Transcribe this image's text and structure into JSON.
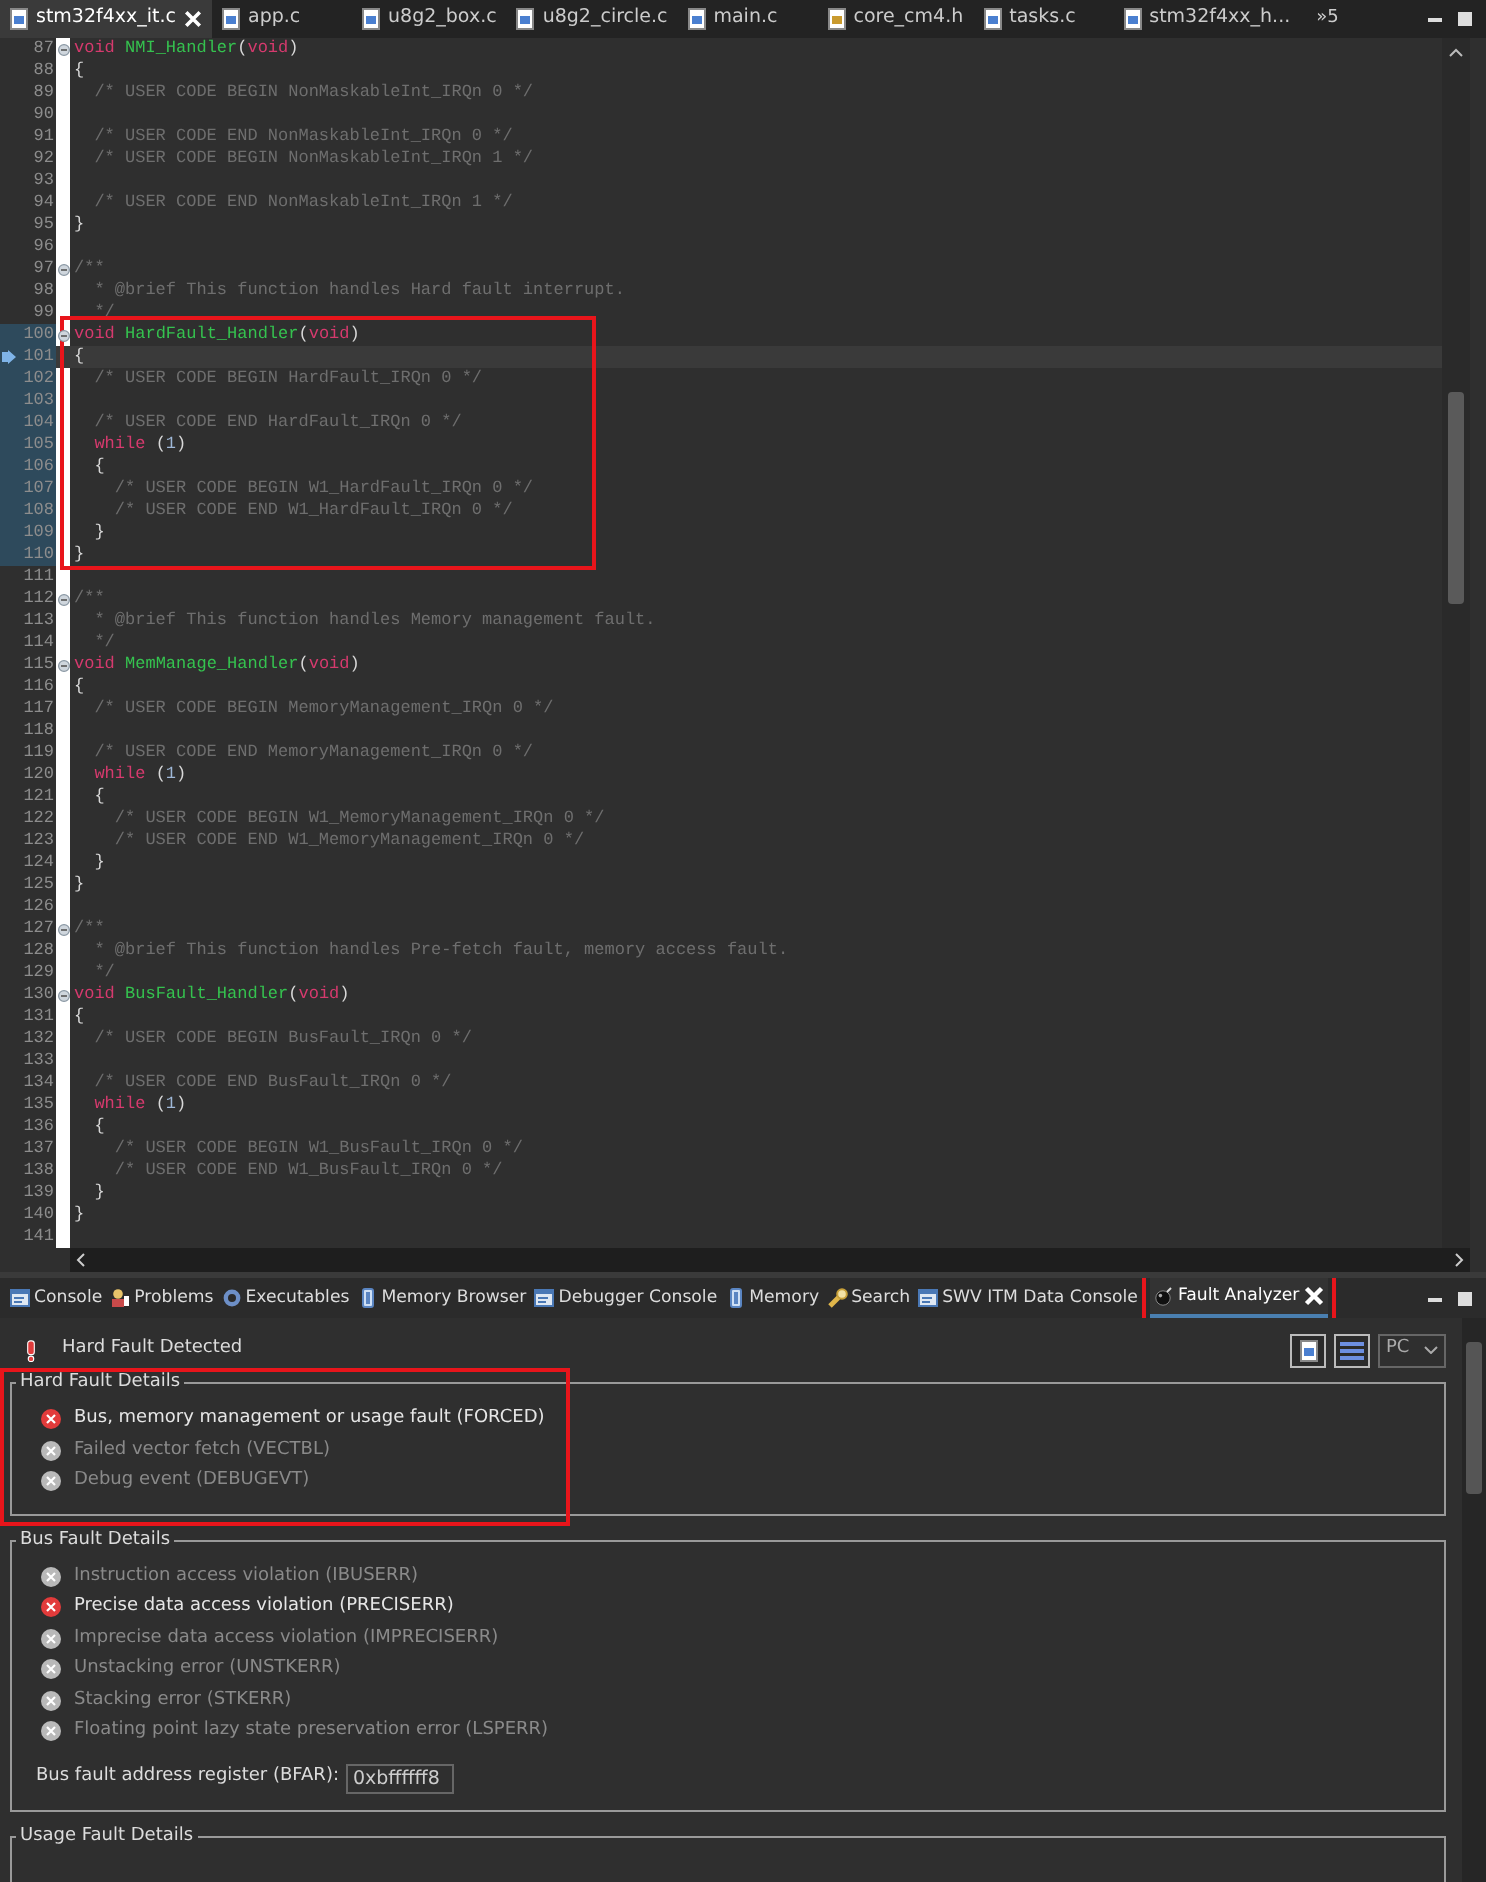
{
  "editor_tabs": [
    {
      "label": "stm32f4xx_it.c",
      "kind": "source",
      "selected": true,
      "closable": true
    },
    {
      "label": "app.c",
      "kind": "source",
      "selected": false
    },
    {
      "label": "u8g2_box.c",
      "kind": "source",
      "selected": false
    },
    {
      "label": "u8g2_circle.c",
      "kind": "source",
      "selected": false
    },
    {
      "label": "main.c",
      "kind": "source",
      "selected": false
    },
    {
      "label": "core_cm4.h",
      "kind": "header",
      "selected": false
    },
    {
      "label": "tasks.c",
      "kind": "source",
      "selected": false
    },
    {
      "label": "stm32f4xx_h...",
      "kind": "source",
      "selected": false
    }
  ],
  "editor_overflow": "»5",
  "code": {
    "lines": [
      {
        "number": "87",
        "fold": true,
        "tokens": [
          {
            "kind": "keyword",
            "text": "void "
          },
          {
            "kind": "function",
            "text": "NMI_Handler"
          },
          {
            "kind": "plain",
            "text": "("
          },
          {
            "kind": "keyword",
            "text": "void"
          },
          {
            "kind": "plain",
            "text": ")"
          }
        ]
      },
      {
        "number": "88",
        "tokens": [
          {
            "kind": "plain",
            "text": "{"
          }
        ]
      },
      {
        "number": "89",
        "tokens": [
          {
            "kind": "comment",
            "text": "  /* USER CODE BEGIN NonMaskableInt_IRQn 0 */"
          }
        ]
      },
      {
        "number": "90"
      },
      {
        "number": "91",
        "tokens": [
          {
            "kind": "comment",
            "text": "  /* USER CODE END NonMaskableInt_IRQn 0 */"
          }
        ]
      },
      {
        "number": "92",
        "tokens": [
          {
            "kind": "comment",
            "text": "  /* USER CODE BEGIN NonMaskableInt_IRQn 1 */"
          }
        ]
      },
      {
        "number": "93"
      },
      {
        "number": "94",
        "tokens": [
          {
            "kind": "comment",
            "text": "  /* USER CODE END NonMaskableInt_IRQn 1 */"
          }
        ]
      },
      {
        "number": "95",
        "tokens": [
          {
            "kind": "plain",
            "text": "}"
          }
        ]
      },
      {
        "number": "96"
      },
      {
        "number": "97",
        "fold": true,
        "tokens": [
          {
            "kind": "comment",
            "text": "/**"
          }
        ]
      },
      {
        "number": "98",
        "tokens": [
          {
            "kind": "comment",
            "text": "  * @brief This function handles Hard fault interrupt."
          }
        ]
      },
      {
        "number": "99",
        "tokens": [
          {
            "kind": "comment",
            "text": "  */"
          }
        ]
      },
      {
        "number": "100",
        "fold": true,
        "marked": true,
        "boxed": true,
        "tokens": [
          {
            "kind": "keyword",
            "text": "void "
          },
          {
            "kind": "function",
            "text": "HardFault_Handler"
          },
          {
            "kind": "plain",
            "text": "("
          },
          {
            "kind": "keyword",
            "text": "void"
          },
          {
            "kind": "plain",
            "text": ")"
          }
        ]
      },
      {
        "number": "101",
        "marked": true,
        "boxed": true,
        "current": true,
        "tokens": [
          {
            "kind": "plain",
            "text": "{"
          }
        ]
      },
      {
        "number": "102",
        "marked": true,
        "boxed": true,
        "tokens": [
          {
            "kind": "comment",
            "text": "  /* USER CODE BEGIN HardFault_IRQn 0 */"
          }
        ]
      },
      {
        "number": "103",
        "marked": true,
        "boxed": true
      },
      {
        "number": "104",
        "marked": true,
        "boxed": true,
        "tokens": [
          {
            "kind": "comment",
            "text": "  /* USER CODE END HardFault_IRQn 0 */"
          }
        ]
      },
      {
        "number": "105",
        "marked": true,
        "boxed": true,
        "tokens": [
          {
            "kind": "keyword",
            "text": "  while "
          },
          {
            "kind": "plain",
            "text": "("
          },
          {
            "kind": "number",
            "text": "1"
          },
          {
            "kind": "plain",
            "text": ")"
          }
        ]
      },
      {
        "number": "106",
        "marked": true,
        "boxed": true,
        "tokens": [
          {
            "kind": "plain",
            "text": "  {"
          }
        ]
      },
      {
        "number": "107",
        "marked": true,
        "boxed": true,
        "tokens": [
          {
            "kind": "comment",
            "text": "    /* USER CODE BEGIN W1_HardFault_IRQn 0 */"
          }
        ]
      },
      {
        "number": "108",
        "marked": true,
        "boxed": true,
        "tokens": [
          {
            "kind": "comment",
            "text": "    /* USER CODE END W1_HardFault_IRQn 0 */"
          }
        ]
      },
      {
        "number": "109",
        "marked": true,
        "boxed": true,
        "tokens": [
          {
            "kind": "plain",
            "text": "  }"
          }
        ]
      },
      {
        "number": "110",
        "marked": true,
        "boxed": true,
        "tokens": [
          {
            "kind": "plain",
            "text": "}"
          }
        ]
      },
      {
        "number": "111"
      },
      {
        "number": "112",
        "fold": true,
        "tokens": [
          {
            "kind": "comment",
            "text": "/**"
          }
        ]
      },
      {
        "number": "113",
        "tokens": [
          {
            "kind": "comment",
            "text": "  * @brief This function handles Memory management fault."
          }
        ]
      },
      {
        "number": "114",
        "tokens": [
          {
            "kind": "comment",
            "text": "  */"
          }
        ]
      },
      {
        "number": "115",
        "fold": true,
        "tokens": [
          {
            "kind": "keyword",
            "text": "void "
          },
          {
            "kind": "function",
            "text": "MemManage_Handler"
          },
          {
            "kind": "plain",
            "text": "("
          },
          {
            "kind": "keyword",
            "text": "void"
          },
          {
            "kind": "plain",
            "text": ")"
          }
        ]
      },
      {
        "number": "116",
        "tokens": [
          {
            "kind": "plain",
            "text": "{"
          }
        ]
      },
      {
        "number": "117",
        "tokens": [
          {
            "kind": "comment",
            "text": "  /* USER CODE BEGIN MemoryManagement_IRQn 0 */"
          }
        ]
      },
      {
        "number": "118"
      },
      {
        "number": "119",
        "tokens": [
          {
            "kind": "comment",
            "text": "  /* USER CODE END MemoryManagement_IRQn 0 */"
          }
        ]
      },
      {
        "number": "120",
        "tokens": [
          {
            "kind": "keyword",
            "text": "  while "
          },
          {
            "kind": "plain",
            "text": "("
          },
          {
            "kind": "number",
            "text": "1"
          },
          {
            "kind": "plain",
            "text": ")"
          }
        ]
      },
      {
        "number": "121",
        "tokens": [
          {
            "kind": "plain",
            "text": "  {"
          }
        ]
      },
      {
        "number": "122",
        "tokens": [
          {
            "kind": "comment",
            "text": "    /* USER CODE BEGIN W1_MemoryManagement_IRQn 0 */"
          }
        ]
      },
      {
        "number": "123",
        "tokens": [
          {
            "kind": "comment",
            "text": "    /* USER CODE END W1_MemoryManagement_IRQn 0 */"
          }
        ]
      },
      {
        "number": "124",
        "tokens": [
          {
            "kind": "plain",
            "text": "  }"
          }
        ]
      },
      {
        "number": "125",
        "tokens": [
          {
            "kind": "plain",
            "text": "}"
          }
        ]
      },
      {
        "number": "126"
      },
      {
        "number": "127",
        "fold": true,
        "tokens": [
          {
            "kind": "comment",
            "text": "/**"
          }
        ]
      },
      {
        "number": "128",
        "tokens": [
          {
            "kind": "comment",
            "text": "  * @brief This function handles Pre-fetch fault, memory access fault."
          }
        ]
      },
      {
        "number": "129",
        "tokens": [
          {
            "kind": "comment",
            "text": "  */"
          }
        ]
      },
      {
        "number": "130",
        "fold": true,
        "tokens": [
          {
            "kind": "keyword",
            "text": "void "
          },
          {
            "kind": "function",
            "text": "BusFault_Handler"
          },
          {
            "kind": "plain",
            "text": "("
          },
          {
            "kind": "keyword",
            "text": "void"
          },
          {
            "kind": "plain",
            "text": ")"
          }
        ]
      },
      {
        "number": "131",
        "tokens": [
          {
            "kind": "plain",
            "text": "{"
          }
        ]
      },
      {
        "number": "132",
        "tokens": [
          {
            "kind": "comment",
            "text": "  /* USER CODE BEGIN BusFault_IRQn 0 */"
          }
        ]
      },
      {
        "number": "133"
      },
      {
        "number": "134",
        "tokens": [
          {
            "kind": "comment",
            "text": "  /* USER CODE END BusFault_IRQn 0 */"
          }
        ]
      },
      {
        "number": "135",
        "tokens": [
          {
            "kind": "keyword",
            "text": "  while "
          },
          {
            "kind": "plain",
            "text": "("
          },
          {
            "kind": "number",
            "text": "1"
          },
          {
            "kind": "plain",
            "text": ")"
          }
        ]
      },
      {
        "number": "136",
        "tokens": [
          {
            "kind": "plain",
            "text": "  {"
          }
        ]
      },
      {
        "number": "137",
        "tokens": [
          {
            "kind": "comment",
            "text": "    /* USER CODE BEGIN W1_BusFault_IRQn 0 */"
          }
        ]
      },
      {
        "number": "138",
        "tokens": [
          {
            "kind": "comment",
            "text": "    /* USER CODE END W1_BusFault_IRQn 0 */"
          }
        ]
      },
      {
        "number": "139",
        "tokens": [
          {
            "kind": "plain",
            "text": "  }"
          }
        ]
      },
      {
        "number": "140",
        "tokens": [
          {
            "kind": "plain",
            "text": "}"
          }
        ]
      },
      {
        "number": "141"
      }
    ]
  },
  "panel_tabs": [
    {
      "label": "Console",
      "kind": "console",
      "selected": false
    },
    {
      "label": "Problems",
      "kind": "problems",
      "selected": false
    },
    {
      "label": "Executables",
      "kind": "executables",
      "selected": false
    },
    {
      "label": "Memory Browser",
      "kind": "memory",
      "selected": false
    },
    {
      "label": "Debugger Console",
      "kind": "console",
      "selected": false
    },
    {
      "label": "Memory",
      "kind": "memory",
      "selected": false
    },
    {
      "label": "Search",
      "kind": "search",
      "selected": false
    },
    {
      "label": "SWV ITM Data Console",
      "kind": "console",
      "selected": false
    },
    {
      "label": "Fault Analyzer",
      "kind": "fault",
      "selected": true,
      "closable": true,
      "boxed": true
    }
  ],
  "fault_analyzer": {
    "status": "Hard Fault Detected",
    "view_select": "PC",
    "groups": [
      {
        "title": "Hard Fault Details",
        "boxed": true,
        "items": [
          {
            "label": "Bus, memory management or usage fault (FORCED)",
            "active": true
          },
          {
            "label": "Failed vector fetch (VECTBL)",
            "active": false
          },
          {
            "label": "Debug event (DEBUGEVT)",
            "active": false
          }
        ]
      },
      {
        "title": "Bus Fault Details",
        "items": [
          {
            "label": "Instruction access violation (IBUSERR)",
            "active": false
          },
          {
            "label": "Precise data access violation (PRECISERR)",
            "active": true
          },
          {
            "label": "Imprecise data access violation (IMPRECISERR)",
            "active": false
          },
          {
            "label": "Unstacking error (UNSTKERR)",
            "active": false
          },
          {
            "label": "Stacking error (STKERR)",
            "active": false
          },
          {
            "label": "Floating point lazy state preservation error (LSPERR)",
            "active": false
          }
        ],
        "register": {
          "label": "Bus fault address register (BFAR):",
          "value": "0xbffffff8"
        }
      },
      {
        "title": "Usage Fault Details"
      }
    ]
  }
}
